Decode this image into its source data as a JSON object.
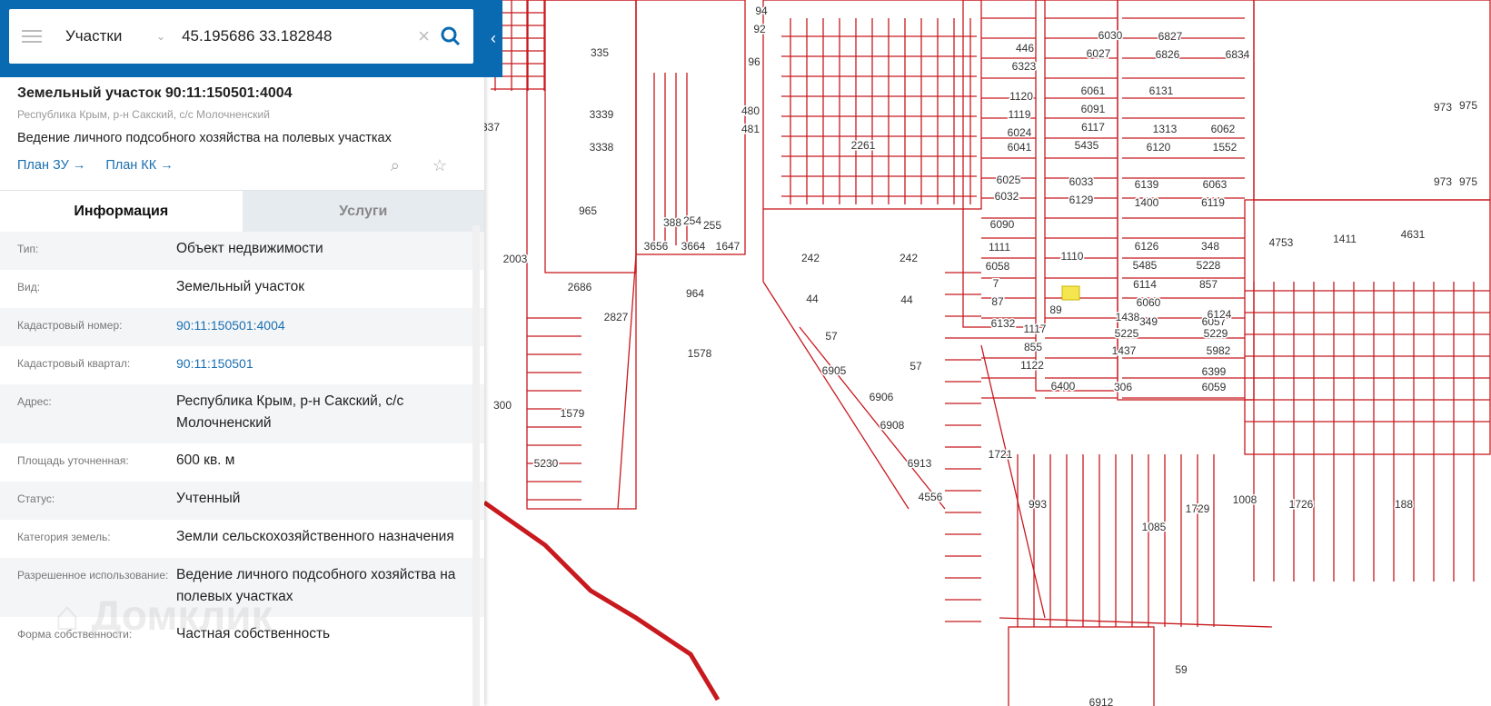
{
  "search": {
    "type": "Участки",
    "query": "45.195686 33.182848"
  },
  "parcel": {
    "title": "Земельный участок 90:11:150501:4004",
    "address_short": "Республика Крым, р-н Сакский, с/с Молочненский",
    "use": "Ведение личного подсобного хозяйства на полевых участках",
    "link_plan_zu": "План ЗУ →",
    "link_plan_kk": "План КК →"
  },
  "tabs": [
    "Информация",
    "Услуги"
  ],
  "info": [
    {
      "label": "Тип:",
      "value": "Объект недвижимости"
    },
    {
      "label": "Вид:",
      "value": "Земельный участок"
    },
    {
      "label": "Кадастровый номер:",
      "value": "90:11:150501:4004",
      "link": true
    },
    {
      "label": "Кадастровый квартал:",
      "value": "90:11:150501",
      "link": true
    },
    {
      "label": "Адрес:",
      "value": "Республика Крым, р-н Сакский, с/с Молочненский"
    },
    {
      "label": "Площадь уточненная:",
      "value": "600 кв. м"
    },
    {
      "label": "Статус:",
      "value": "Учтенный"
    },
    {
      "label": "Категория земель:",
      "value": "Земли сельскохозяйственного назначения"
    },
    {
      "label": "Разрешенное использование:",
      "value": "Ведение личного подсобного хозяйства на полевых участках"
    },
    {
      "label": "Форма собственности:",
      "value": "Частная собственность"
    }
  ],
  "watermark": "Домклик",
  "map": {
    "parcel_color": "#c8191e",
    "highlight_color": "#f5e650",
    "labels": [
      "94",
      "92",
      "96",
      "335",
      "3339",
      "3338",
      "965",
      "337",
      "480",
      "481",
      "2261",
      "3656",
      "3664",
      "1647",
      "388",
      "254",
      "255",
      "2003",
      "2686",
      "2827",
      "964",
      "242",
      "242",
      "44",
      "44",
      "57",
      "57",
      "1578",
      "300",
      "1579",
      "5230",
      "6905",
      "6906",
      "6908",
      "6913",
      "4556",
      "1721",
      "993",
      "1085",
      "1729",
      "1008",
      "1726",
      "188",
      "446",
      "6323",
      "6030",
      "6027",
      "6827",
      "6826",
      "6834",
      "1120",
      "1119",
      "6024",
      "6041",
      "6061",
      "6091",
      "6117",
      "5435",
      "6131",
      "1313",
      "6062",
      "6120",
      "1552",
      "973",
      "975",
      "973",
      "975",
      "6025",
      "6032",
      "6033",
      "6129",
      "6139",
      "6063",
      "1400",
      "6119",
      "6090",
      "1111",
      "6058",
      "7",
      "87",
      "1110",
      "6126",
      "348",
      "5485",
      "5228",
      "6114",
      "857",
      "6060",
      "349",
      "6057",
      "89",
      "1117",
      "855",
      "1122",
      "6400",
      "306",
      "6059",
      "1438",
      "6124",
      "5225",
      "5229",
      "1437",
      "5982",
      "6399",
      "6132",
      "4753",
      "1411",
      "4631",
      "6912",
      "59"
    ]
  }
}
